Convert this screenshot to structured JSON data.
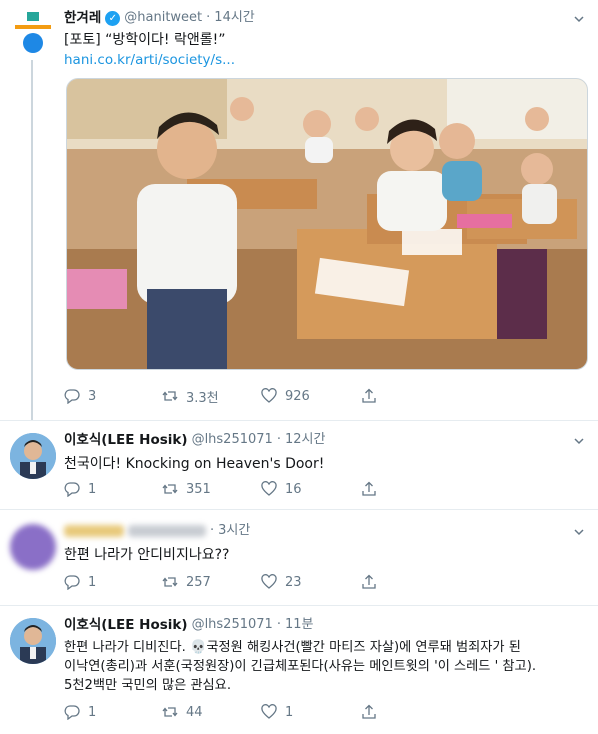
{
  "tweets": [
    {
      "name": "한겨레",
      "handle": "@hanitweet",
      "dot": "·",
      "time": "14시간",
      "text": "[포토] “방학이다! 락앤롤!”",
      "link": "hani.co.kr/arti/society/s...",
      "replies": "3",
      "retweets": "3.3천",
      "likes": "926"
    },
    {
      "name": "이호식(LEE Hosik)",
      "handle": "@lhs251071",
      "dot": "·",
      "time": "12시간",
      "text": "천국이다!  Knocking on Heaven's Door!",
      "replies": "1",
      "retweets": "351",
      "likes": "16"
    },
    {
      "name": "",
      "handle": "",
      "dot": "·",
      "time": "3시간",
      "text": "한편 나라가 안디비지나요??",
      "replies": "1",
      "retweets": "257",
      "likes": "23"
    },
    {
      "name": "이호식(LEE Hosik)",
      "handle": "@lhs251071",
      "dot": "·",
      "time": "11분",
      "text_lines": [
        "한편 나라가 디비진다. 💀국정원 해킹사건(빨간 마티즈 자살)에 연루돼 범죄자가 된",
        "이낙연(총리)과 서훈(국정원장)이 긴급체포된다(사유는 메인트윗의 '이 스레드 ' 참고).",
        "5천2백만 국민의 많은 관심요."
      ],
      "replies": "1",
      "retweets": "44",
      "likes": "1"
    }
  ],
  "colors": {
    "accent": "#1da1f2",
    "link": "#1b95e0",
    "secondary": "#657786",
    "border": "#e6ecf0"
  }
}
